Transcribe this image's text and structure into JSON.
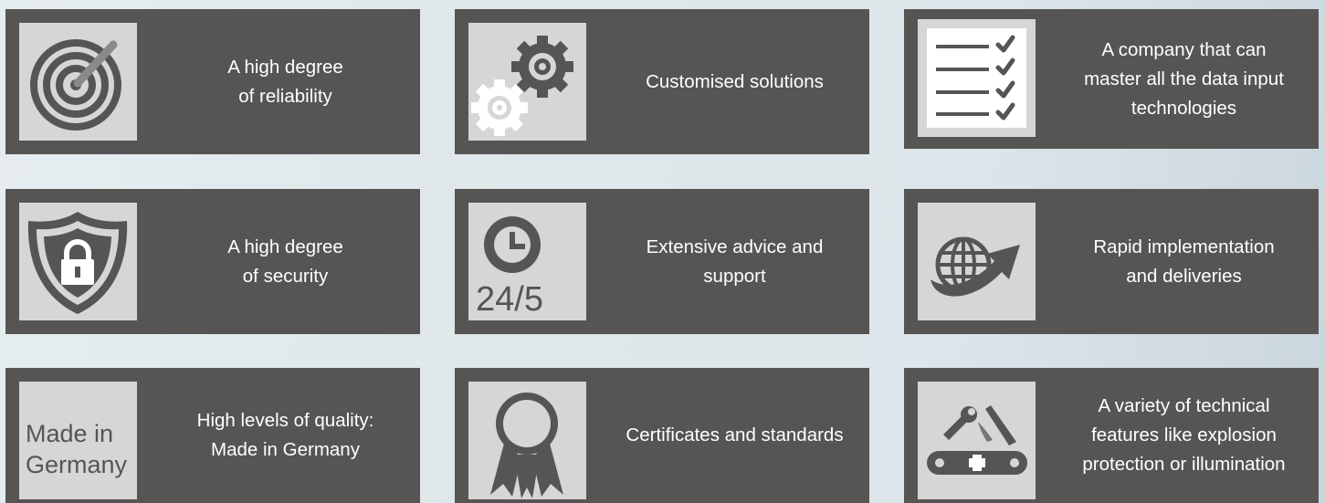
{
  "tiles": [
    {
      "id": "reliability",
      "icon": "target-icon",
      "lines": [
        "A high degree",
        "of reliability"
      ]
    },
    {
      "id": "customised",
      "icon": "gears-icon",
      "lines": [
        "Customised solutions"
      ]
    },
    {
      "id": "data-input",
      "icon": "checklist-icon",
      "lines": [
        "A company that can",
        "master all the data input",
        "technologies"
      ]
    },
    {
      "id": "security",
      "icon": "shield-lock-icon",
      "lines": [
        "A high degree",
        "of security"
      ]
    },
    {
      "id": "support",
      "icon": "clock-icon",
      "icon_text": "24/5",
      "lines": [
        "Extensive advice and",
        "support"
      ]
    },
    {
      "id": "implementation",
      "icon": "globe-arrow-icon",
      "lines": [
        "Rapid implementation",
        "and deliveries"
      ]
    },
    {
      "id": "quality",
      "icon": "made-in-germany-icon",
      "icon_text_lines": [
        "Made in",
        "Germany"
      ],
      "lines": [
        "High levels of quality:",
        "Made in Germany"
      ]
    },
    {
      "id": "certificates",
      "icon": "rosette-icon",
      "lines": [
        "Certificates and standards"
      ]
    },
    {
      "id": "features",
      "icon": "multitool-icon",
      "lines": [
        "A variety of technical",
        "features like explosion",
        "protection or illumination"
      ]
    }
  ],
  "colors": {
    "tile": "#565554",
    "icon_bg": "#d6d6d6",
    "icon_fg": "#565554",
    "text": "#ffffff"
  }
}
